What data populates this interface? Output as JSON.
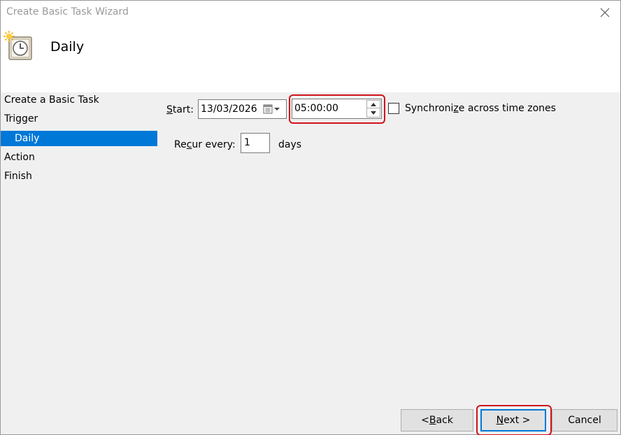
{
  "window": {
    "title": "Create Basic Task Wizard"
  },
  "header": {
    "title": "Daily",
    "icon": "scheduled-task-clock-icon"
  },
  "sidebar": {
    "items": [
      {
        "label": "Create a Basic Task",
        "selected": false
      },
      {
        "label": "Trigger",
        "selected": false
      },
      {
        "label": "Daily",
        "selected": true
      },
      {
        "label": "Action",
        "selected": false
      },
      {
        "label": "Finish",
        "selected": false
      }
    ]
  },
  "form": {
    "start_label_prefix": "",
    "start_label_access": "S",
    "start_label_rest": "tart:",
    "start_date": "13/03/2026",
    "start_time": "05:00:00",
    "sync_label_pre": "Synchroni",
    "sync_label_access": "z",
    "sync_label_post": "e across time zones",
    "sync_checked": false,
    "recur_label_pre": "Re",
    "recur_label_access": "c",
    "recur_label_post": "ur every:",
    "recur_value": "1",
    "recur_unit": "days"
  },
  "buttons": {
    "back_pre": "< ",
    "back_access": "B",
    "back_post": "ack",
    "next_access": "N",
    "next_post": "ext >",
    "cancel": "Cancel"
  },
  "colors": {
    "accent": "#0078d7",
    "highlight_ring": "#d0141b"
  }
}
